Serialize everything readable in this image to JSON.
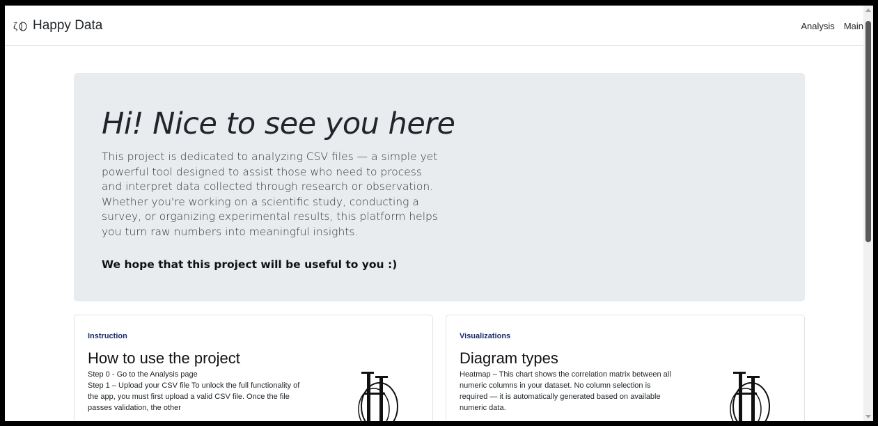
{
  "navbar": {
    "brand_name": "Happy Data",
    "links": [
      "Analysis",
      "Main"
    ]
  },
  "hero": {
    "title": "Hi! Nice to see you here",
    "lead": "This project is dedicated to analyzing CSV files — a simple yet powerful tool designed to assist those who need to process and interpret data collected through research or observation. Whether you're working on a scientific study, conducting a survey, or organizing experimental results, this platform helps you turn raw numbers into meaningful insights.",
    "closing": "We hope that this project will be useful to you :)"
  },
  "cards": [
    {
      "eyebrow": "Instruction",
      "title": "How to use the project",
      "lines": [
        "Step 0 - Go to the Analysis page",
        "Step 1 – Upload your CSV file To unlock the full functionality of the app, you must first upload a valid CSV file. Once the file passes validation, the other"
      ]
    },
    {
      "eyebrow": "Visualizations",
      "title": "Diagram types",
      "lines": [
        "Heatmap – This chart shows the correlation matrix between all numeric columns in your dataset. No column selection is required — it is automatically generated based on available numeric data."
      ]
    }
  ],
  "colors": {
    "hero_bg": "#e9ecef",
    "eyebrow": "#1a2f6e"
  }
}
